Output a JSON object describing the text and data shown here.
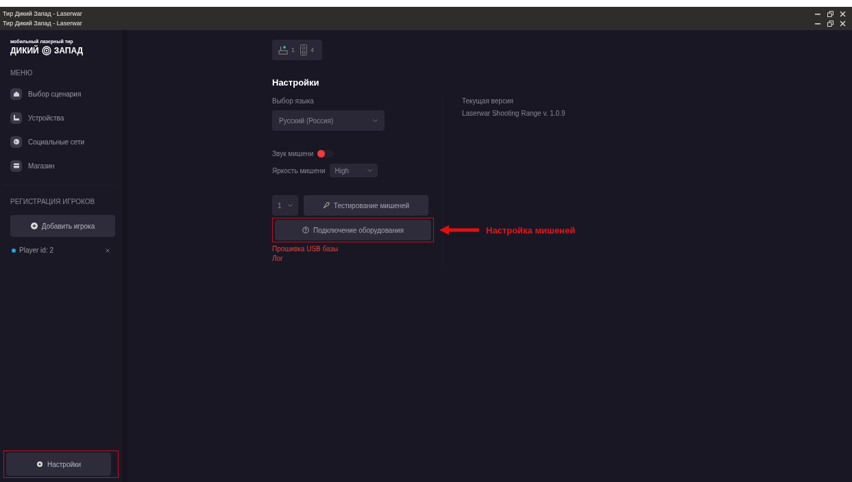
{
  "window": {
    "titles": [
      "Тир Дикий Запад - Laserwar",
      "Тир Дикий Запад - Laserwar"
    ]
  },
  "sidebar": {
    "logo": {
      "tagline": "мобильный лазерный тир",
      "name_left": "ДИКИЙ",
      "name_right": "ЗАПАД"
    },
    "menu_heading": "МЕНЮ",
    "items": [
      {
        "kind": "home",
        "label": "Выбор сценария",
        "selected": false
      },
      {
        "kind": "devices",
        "label": "Устройства",
        "selected": false
      },
      {
        "kind": "globe",
        "label": "Социальные сети",
        "selected": false
      },
      {
        "kind": "shop",
        "label": "Магазин",
        "selected": false
      }
    ],
    "players_heading": "РЕГИСТРАЦИЯ ИГРОКОВ",
    "add_player": "Добавить игрока",
    "players": [
      {
        "label": "Player id: 2",
        "color": "#1ea7e8"
      }
    ],
    "settings_button": {
      "label": "Настройки",
      "highlighted": true
    }
  },
  "device_counts": [
    {
      "kind": "base",
      "count": "1"
    },
    {
      "kind": "target",
      "count": "4"
    }
  ],
  "settings": {
    "title": "Настройки",
    "language_label": "Выбор языка",
    "language": "Русский (Россия)",
    "sound_label": "Звук мишени",
    "sound_on": false,
    "brightness_label": "Яркость мишени",
    "brightness": "High",
    "target_number": "1",
    "test_button": "Тестирование мишеней",
    "connect_button": {
      "label": "Подключение оборудования",
      "highlighted": true
    },
    "links": [
      "Прошивка USB базы",
      "Лог"
    ],
    "version_label": "Текущая версия",
    "version": "Laserwar Shooting Range v. 1.0.9"
  },
  "callout": {
    "text": "Настройка мишеней"
  }
}
